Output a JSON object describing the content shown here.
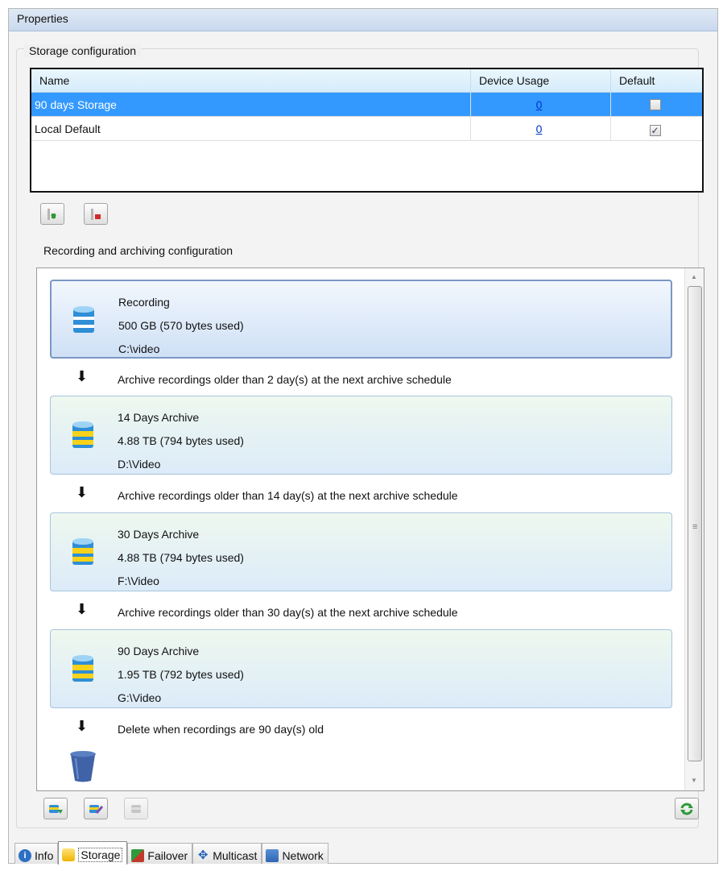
{
  "window": {
    "title": "Properties"
  },
  "storage": {
    "group_title": "Storage configuration",
    "columns": [
      "Name",
      "Device Usage",
      "Default"
    ],
    "rows": [
      {
        "name": "90 days Storage",
        "usage": "0",
        "default": false,
        "selected": true
      },
      {
        "name": "Local Default",
        "usage": "0",
        "default": true,
        "selected": false
      }
    ],
    "toolbar": [
      {
        "icon": "add-storage-icon",
        "enabled": true
      },
      {
        "icon": "remove-storage-icon",
        "enabled": true
      }
    ]
  },
  "archiving": {
    "label": "Recording and archiving configuration",
    "items": [
      {
        "kind": "recording",
        "title": "Recording",
        "size": "500 GB (570 bytes used)",
        "path": "C:\\video"
      },
      {
        "kind": "step",
        "text": "Archive recordings older than 2 day(s) at the next archive schedule"
      },
      {
        "kind": "archive",
        "title": "14 Days Archive",
        "size": "4.88 TB (794 bytes used)",
        "path": "D:\\Video"
      },
      {
        "kind": "step",
        "text": "Archive recordings older than 14 day(s) at the next archive schedule"
      },
      {
        "kind": "archive",
        "title": "30 Days Archive",
        "size": "4.88 TB (794 bytes used)",
        "path": "F:\\Video"
      },
      {
        "kind": "step",
        "text": "Archive recordings older than 30 day(s) at the next archive schedule"
      },
      {
        "kind": "archive",
        "title": "90 Days Archive",
        "size": "1.95 TB (792 bytes used)",
        "path": "G:\\Video"
      },
      {
        "kind": "step",
        "text": "Delete when recordings are 90 day(s) old"
      }
    ],
    "toolbar": [
      {
        "icon": "add-archive-icon",
        "enabled": true
      },
      {
        "icon": "edit-archive-icon",
        "enabled": true
      },
      {
        "icon": "delete-archive-icon",
        "enabled": false
      }
    ],
    "refresh_icon": "refresh-icon"
  },
  "tabs": [
    {
      "label": "Info",
      "icon": "info-icon",
      "active": false
    },
    {
      "label": "Storage",
      "icon": "storage-icon",
      "active": true
    },
    {
      "label": "Failover",
      "icon": "failover-icon",
      "active": false
    },
    {
      "label": "Multicast",
      "icon": "multicast-icon",
      "active": false
    },
    {
      "label": "Network",
      "icon": "network-icon",
      "active": false
    }
  ],
  "colors": {
    "selection": "#3399ff",
    "link": "#0033cc",
    "db_blue": "#2f8ed6",
    "db_yellow": "#f6d21a",
    "trash": "#3f63a6"
  }
}
